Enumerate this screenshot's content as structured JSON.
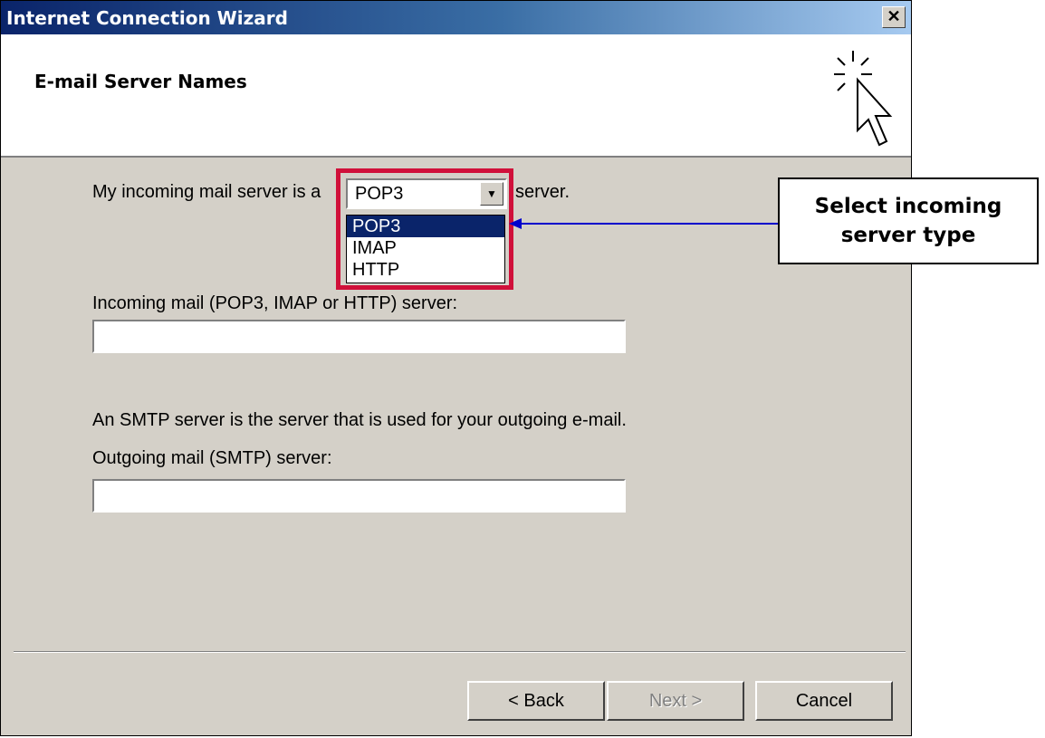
{
  "window": {
    "title": "Internet Connection Wizard",
    "close_glyph": "✕"
  },
  "header": {
    "title": "E-mail Server Names",
    "icon": "wizard-cursor-icon"
  },
  "form": {
    "incoming_type_label": "My incoming mail server is a",
    "incoming_type_value": "POP3",
    "incoming_type_suffix": "server.",
    "dropdown_options": [
      "POP3",
      "IMAP",
      "HTTP"
    ],
    "dropdown_selected": "POP3",
    "incoming_server_label": "Incoming mail (POP3, IMAP or HTTP) server:",
    "incoming_server_value": "",
    "smtp_description": "An SMTP server is the server that is used for your outgoing e-mail.",
    "outgoing_server_label": "Outgoing mail (SMTP) server:",
    "outgoing_server_value": ""
  },
  "buttons": {
    "back": "< Back",
    "next": "Next >",
    "cancel": "Cancel"
  },
  "annotation": {
    "callout_text": "Select incoming server type",
    "highlight_color": "#d0103a",
    "arrow_color": "#0000cc"
  },
  "colors": {
    "titlebar_start": "#0a246a",
    "titlebar_end": "#a6caf0",
    "dialog_bg": "#d4d0c8",
    "selection": "#0a246a"
  }
}
